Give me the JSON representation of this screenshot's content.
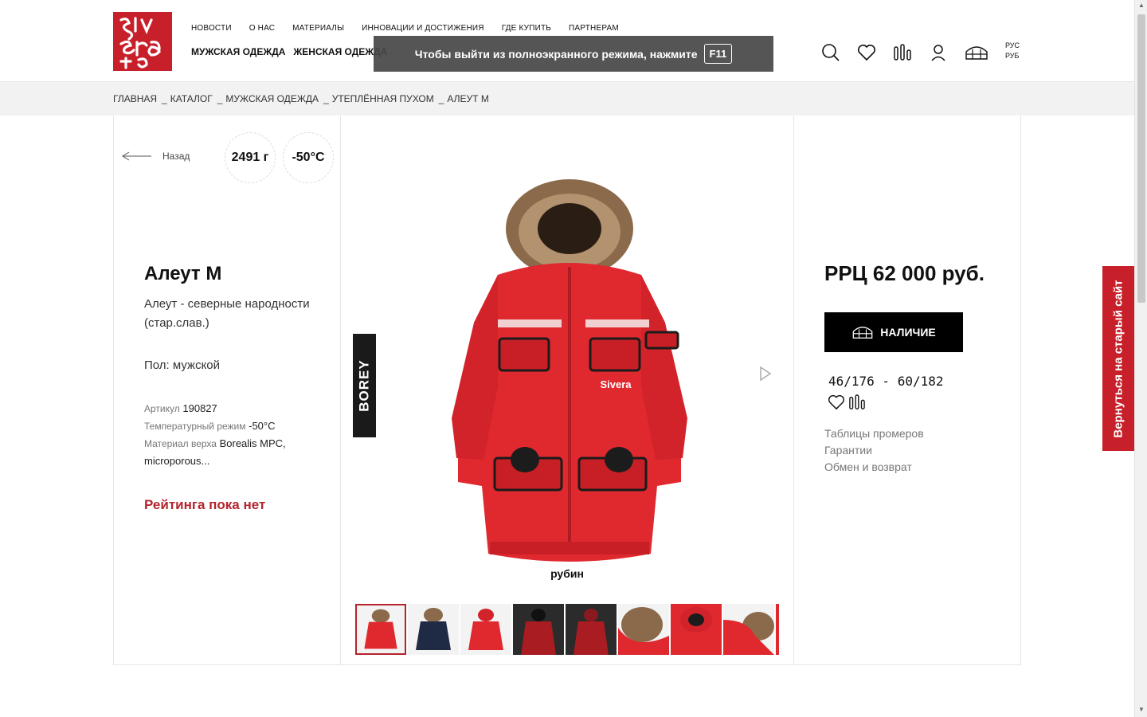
{
  "header": {
    "logo_text": "SIVERA",
    "top_nav": [
      "НОВОСТИ",
      "О НАС",
      "МАТЕРИАЛЫ",
      "ИННОВАЦИИ И ДОСТИЖЕНИЯ",
      "ГДЕ КУПИТЬ",
      "ПАРТНЕРАМ"
    ],
    "main_nav": [
      "МУЖСКАЯ ОДЕЖДА",
      "ЖЕНСКАЯ ОДЕЖДА"
    ],
    "icons": [
      "search-icon",
      "heart-icon",
      "compare-icon",
      "user-icon",
      "store-icon"
    ],
    "lang": "РУС",
    "currency": "РУБ"
  },
  "fullscreen_notice": {
    "text": "Чтобы выйти из полноэкранного режима, нажмите",
    "key": "F11"
  },
  "breadcrumb": [
    "ГЛАВНАЯ",
    "КАТАЛОГ",
    "МУЖСКАЯ ОДЕЖДА",
    "УТЕПЛЁННАЯ ПУХОМ",
    "АЛЕУТ М"
  ],
  "product": {
    "back_label": "Назад",
    "weight": "2491 г",
    "temperature": "-50°C",
    "name": "Алеут М",
    "description": "Алеут - северные народности (стар.слав.)",
    "gender": "Пол: мужской",
    "article_label": "Артикул",
    "article": "190827",
    "temp_label": "Температурный режим",
    "temp_value": "-50°C",
    "material_label": "Материал верха",
    "material_value": "Borealis MPC, microporous...",
    "rating": "Рейтинга пока нет",
    "line_badge": "BOREY",
    "color": "рубин",
    "price": "РРЦ 62 000 руб.",
    "availability_button": "НАЛИЧИЕ",
    "sizes": "46/176 - 60/182",
    "links": [
      "Таблицы промеров",
      "Гарантии",
      "Обмен и возврат"
    ],
    "accent_color": "#c8202a"
  },
  "side_tab": "Вернуться на старый сайт"
}
